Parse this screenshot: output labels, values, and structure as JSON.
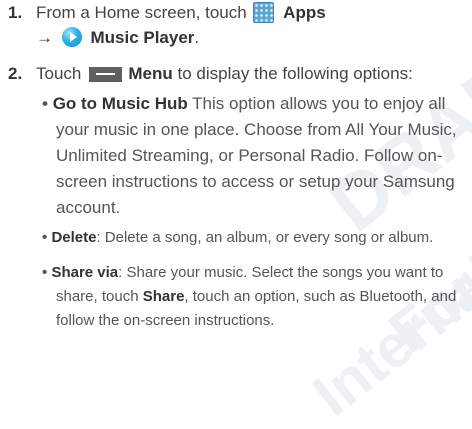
{
  "watermark": {
    "line1": "DRAFT",
    "line2": "For",
    "line3": "Internal"
  },
  "step1": {
    "number": "1.",
    "text_a": "From a Home screen, touch",
    "apps_label": "Apps",
    "arrow": "→",
    "music_label": "Music Player",
    "period": "."
  },
  "step2": {
    "number": "2.",
    "text_a": "Touch",
    "menu_label": "Menu",
    "text_b": "to display the following options:"
  },
  "bullet1": {
    "term": "Go to Music Hub",
    "l1": " This option allows you to enjoy all",
    "l2": "your music in one place. Choose from All Your Music,",
    "l3": "Unlimited Streaming, or Personal Radio. Follow on-",
    "l4": "screen instructions to access or setup your Samsung",
    "l5": "account."
  },
  "bullet2": {
    "term": "Delete",
    "text": ": Delete a song, an album, or every song or album."
  },
  "bullet3": {
    "term": "Share via",
    "l1": ": Share your music. Select the songs you want to",
    "l2a": "share, touch ",
    "share_word": "Share",
    "l2b": ", touch an option, such as Bluetooth, and",
    "l3": "follow the on-screen instructions."
  },
  "icons": {
    "apps": "apps-grid-icon",
    "music": "music-player-icon",
    "menu": "menu-key-icon"
  }
}
